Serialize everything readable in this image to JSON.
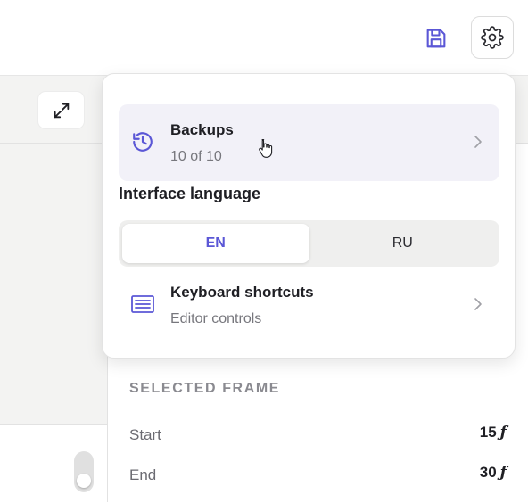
{
  "toolbar": {
    "save_icon": "save-icon",
    "settings_icon": "gear-icon"
  },
  "left_panel": {
    "expand_icon": "expand-icon"
  },
  "popover": {
    "backups": {
      "title": "Backups",
      "subtitle": "10 of 10",
      "icon": "history-icon"
    },
    "language": {
      "heading": "Interface language",
      "options": [
        "EN",
        "RU"
      ],
      "selected": "EN"
    },
    "shortcuts": {
      "title": "Keyboard shortcuts",
      "subtitle": "Editor controls",
      "icon": "keyboard-icon"
    }
  },
  "selected_frame": {
    "title": "SELECTED FRAME",
    "rows": [
      {
        "label": "Start",
        "value": "15",
        "unit": "ƒ"
      },
      {
        "label": "End",
        "value": "30",
        "unit": "ƒ"
      }
    ]
  },
  "colors": {
    "accent": "#5b57d6",
    "hover_bg": "#f2f1f8",
    "panel_bg": "#f3f3f2"
  }
}
